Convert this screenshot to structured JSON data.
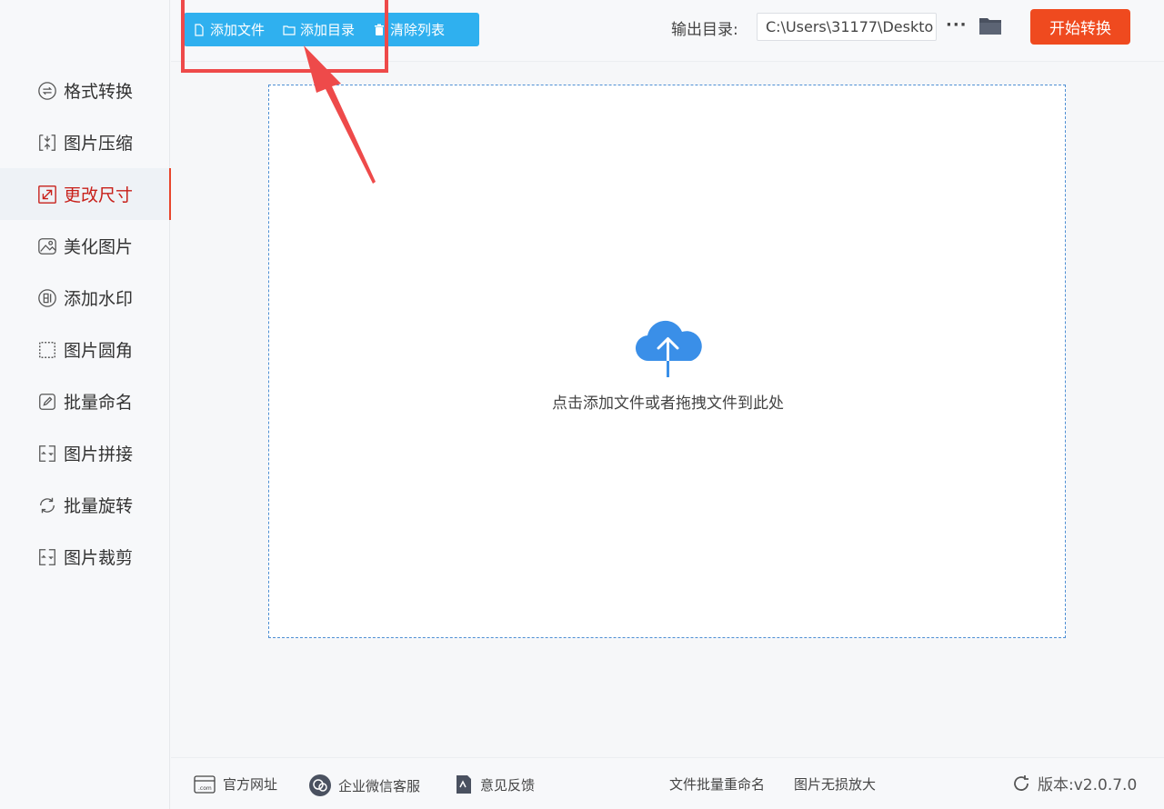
{
  "sidebar": {
    "items": [
      {
        "label": "格式转换",
        "icon": "format-convert-icon",
        "active": false
      },
      {
        "label": "图片压缩",
        "icon": "compress-icon",
        "active": false
      },
      {
        "label": "更改尺寸",
        "icon": "resize-icon",
        "active": true
      },
      {
        "label": "美化图片",
        "icon": "beautify-icon",
        "active": false
      },
      {
        "label": "添加水印",
        "icon": "watermark-icon",
        "active": false
      },
      {
        "label": "图片圆角",
        "icon": "round-corner-icon",
        "active": false
      },
      {
        "label": "批量命名",
        "icon": "rename-icon",
        "active": false
      },
      {
        "label": "图片拼接",
        "icon": "stitch-icon",
        "active": false
      },
      {
        "label": "批量旋转",
        "icon": "rotate-icon",
        "active": false
      },
      {
        "label": "图片裁剪",
        "icon": "crop-icon",
        "active": false
      }
    ]
  },
  "toolbar": {
    "add_file": "添加文件",
    "add_dir": "添加目录",
    "clear_list": "清除列表",
    "output_label": "输出目录:",
    "output_path": "C:\\Users\\31177\\Deskto",
    "more": "···",
    "start": "开始转换"
  },
  "dropzone": {
    "hint": "点击添加文件或者拖拽文件到此处"
  },
  "footer": {
    "website": "官方网址",
    "wechat": "企业微信客服",
    "feedback": "意见反馈",
    "batch_rename": "文件批量重命名",
    "lossless": "图片无损放大",
    "version": "版本:v2.0.7.0"
  },
  "colors": {
    "accent_blue": "#2fb0ef",
    "start_orange": "#ef4a1f",
    "annotation_red": "#ee4a4a",
    "active_red": "#c8201a"
  }
}
